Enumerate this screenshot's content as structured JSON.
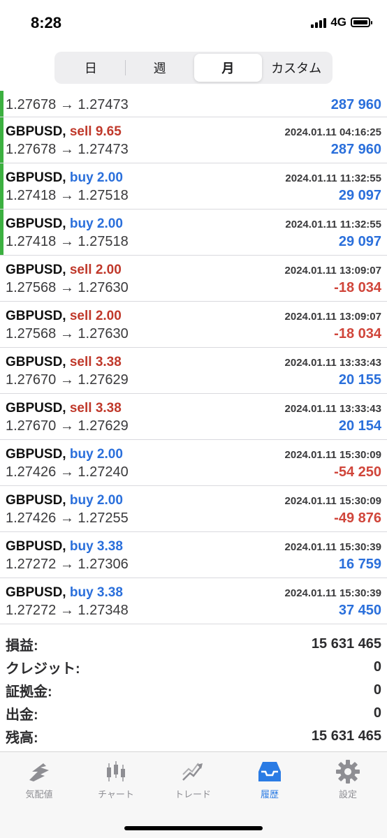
{
  "status": {
    "time": "8:28",
    "network": "4G"
  },
  "segments": [
    "日",
    "週",
    "月",
    "カスタム"
  ],
  "trades_first_partial": {
    "prices": "1.27678 → 1.27473",
    "profit": "287 960"
  },
  "trades": [
    {
      "symbol": "GBPUSD,",
      "side": "sell",
      "lots": "sell 9.65",
      "time": "2024.01.11 04:16:25",
      "prices": "1.27678 → 1.27473",
      "profit": "287 960",
      "sign": "pos",
      "accent": true
    },
    {
      "symbol": "GBPUSD,",
      "side": "buy",
      "lots": "buy 2.00",
      "time": "2024.01.11 11:32:55",
      "prices": "1.27418 → 1.27518",
      "profit": "29 097",
      "sign": "pos",
      "accent": true
    },
    {
      "symbol": "GBPUSD,",
      "side": "buy",
      "lots": "buy 2.00",
      "time": "2024.01.11 11:32:55",
      "prices": "1.27418 → 1.27518",
      "profit": "29 097",
      "sign": "pos",
      "accent": true
    },
    {
      "symbol": "GBPUSD,",
      "side": "sell",
      "lots": "sell 2.00",
      "time": "2024.01.11 13:09:07",
      "prices": "1.27568 → 1.27630",
      "profit": "-18 034",
      "sign": "neg",
      "accent": false
    },
    {
      "symbol": "GBPUSD,",
      "side": "sell",
      "lots": "sell 2.00",
      "time": "2024.01.11 13:09:07",
      "prices": "1.27568 → 1.27630",
      "profit": "-18 034",
      "sign": "neg",
      "accent": false
    },
    {
      "symbol": "GBPUSD,",
      "side": "sell",
      "lots": "sell 3.38",
      "time": "2024.01.11 13:33:43",
      "prices": "1.27670 → 1.27629",
      "profit": "20 155",
      "sign": "pos",
      "accent": false
    },
    {
      "symbol": "GBPUSD,",
      "side": "sell",
      "lots": "sell 3.38",
      "time": "2024.01.11 13:33:43",
      "prices": "1.27670 → 1.27629",
      "profit": "20 154",
      "sign": "pos",
      "accent": false
    },
    {
      "symbol": "GBPUSD,",
      "side": "buy",
      "lots": "buy 2.00",
      "time": "2024.01.11 15:30:09",
      "prices": "1.27426 → 1.27240",
      "profit": "-54 250",
      "sign": "neg",
      "accent": false
    },
    {
      "symbol": "GBPUSD,",
      "side": "buy",
      "lots": "buy 2.00",
      "time": "2024.01.11 15:30:09",
      "prices": "1.27426 → 1.27255",
      "profit": "-49 876",
      "sign": "neg",
      "accent": false
    },
    {
      "symbol": "GBPUSD,",
      "side": "buy",
      "lots": "buy 3.38",
      "time": "2024.01.11 15:30:39",
      "prices": "1.27272 → 1.27306",
      "profit": "16 759",
      "sign": "pos",
      "accent": false
    },
    {
      "symbol": "GBPUSD,",
      "side": "buy",
      "lots": "buy 3.38",
      "time": "2024.01.11 15:30:39",
      "prices": "1.27272 → 1.27348",
      "profit": "37 450",
      "sign": "pos",
      "accent": false
    }
  ],
  "summary": [
    {
      "label": "損益:",
      "value": "15 631 465"
    },
    {
      "label": "クレジット:",
      "value": "0"
    },
    {
      "label": "証拠金:",
      "value": "0"
    },
    {
      "label": "出金:",
      "value": "0"
    },
    {
      "label": "残高:",
      "value": "15 631 465"
    }
  ],
  "tabs": [
    {
      "label": "気配値",
      "icon": "quotes-icon"
    },
    {
      "label": "チャート",
      "icon": "chart-icon"
    },
    {
      "label": "トレード",
      "icon": "trade-icon"
    },
    {
      "label": "履歴",
      "icon": "history-icon"
    },
    {
      "label": "設定",
      "icon": "settings-icon"
    }
  ],
  "colors": {
    "accent_green": "#3cb040",
    "buy_blue": "#2a6fdb",
    "sell_red": "#c0392b",
    "active_tab": "#2a7be4"
  }
}
